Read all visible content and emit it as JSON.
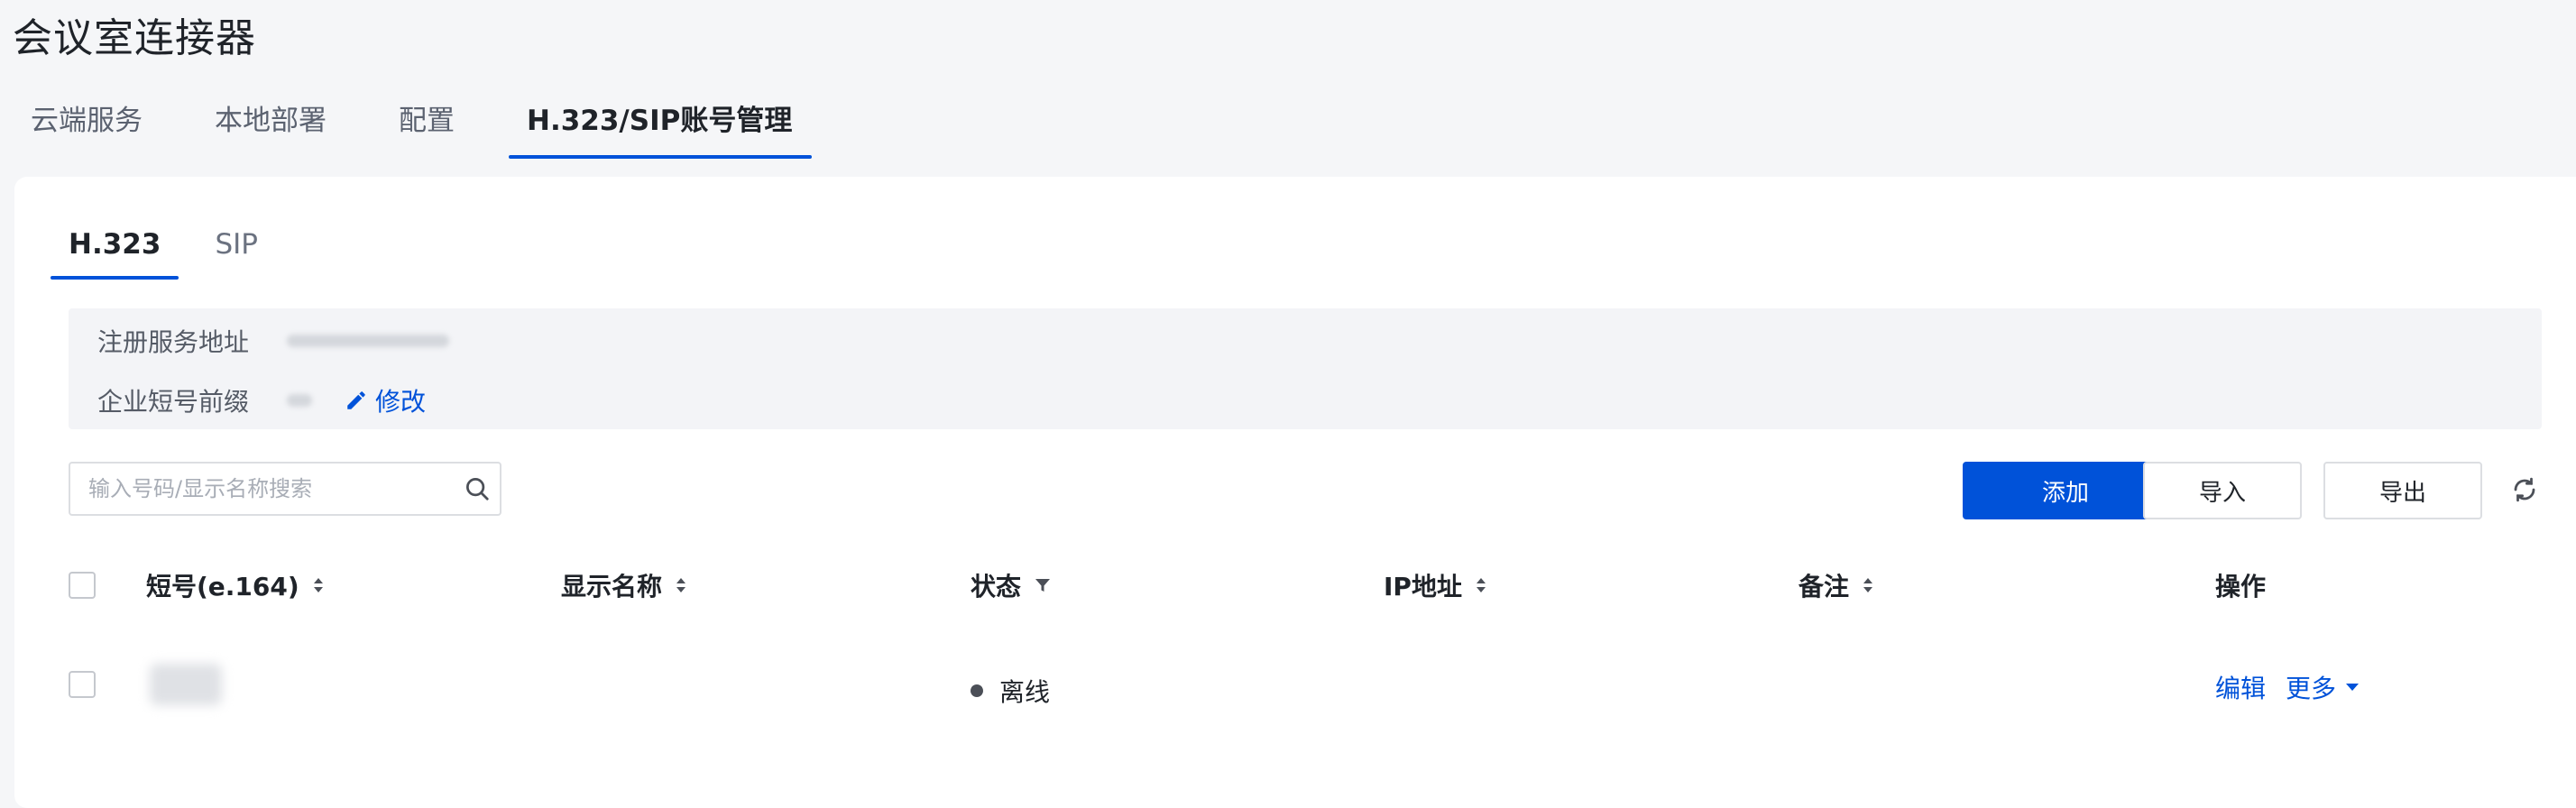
{
  "page": {
    "title": "会议室连接器"
  },
  "top_tabs": [
    {
      "label": "云端服务"
    },
    {
      "label": "本地部署"
    },
    {
      "label": "配置"
    },
    {
      "label": "H.323/SIP账号管理",
      "active": true
    }
  ],
  "sub_tabs": [
    {
      "label": "H.323",
      "active": true
    },
    {
      "label": "SIP"
    }
  ],
  "info": {
    "register_label": "注册服务地址",
    "prefix_label": "企业短号前缀",
    "edit_label": "修改"
  },
  "search": {
    "placeholder": "输入号码/显示名称搜索",
    "value": ""
  },
  "toolbar": {
    "add_label": "添加",
    "import_label": "导入",
    "export_label": "导出"
  },
  "table": {
    "columns": [
      {
        "label": "短号(e.164)",
        "sortable": true
      },
      {
        "label": "显示名称",
        "sortable": true
      },
      {
        "label": "状态",
        "filterable": true
      },
      {
        "label": "IP地址",
        "sortable": true
      },
      {
        "label": "备注",
        "sortable": true
      },
      {
        "label": "操作"
      }
    ],
    "rows": [
      {
        "short_number": "",
        "display_name": "",
        "status": "离线",
        "ip": "",
        "remark": "",
        "actions": {
          "edit": "编辑",
          "more": "更多"
        }
      }
    ]
  },
  "colors": {
    "accent": "#0052d9",
    "offline_dot": "#4b4f57"
  }
}
